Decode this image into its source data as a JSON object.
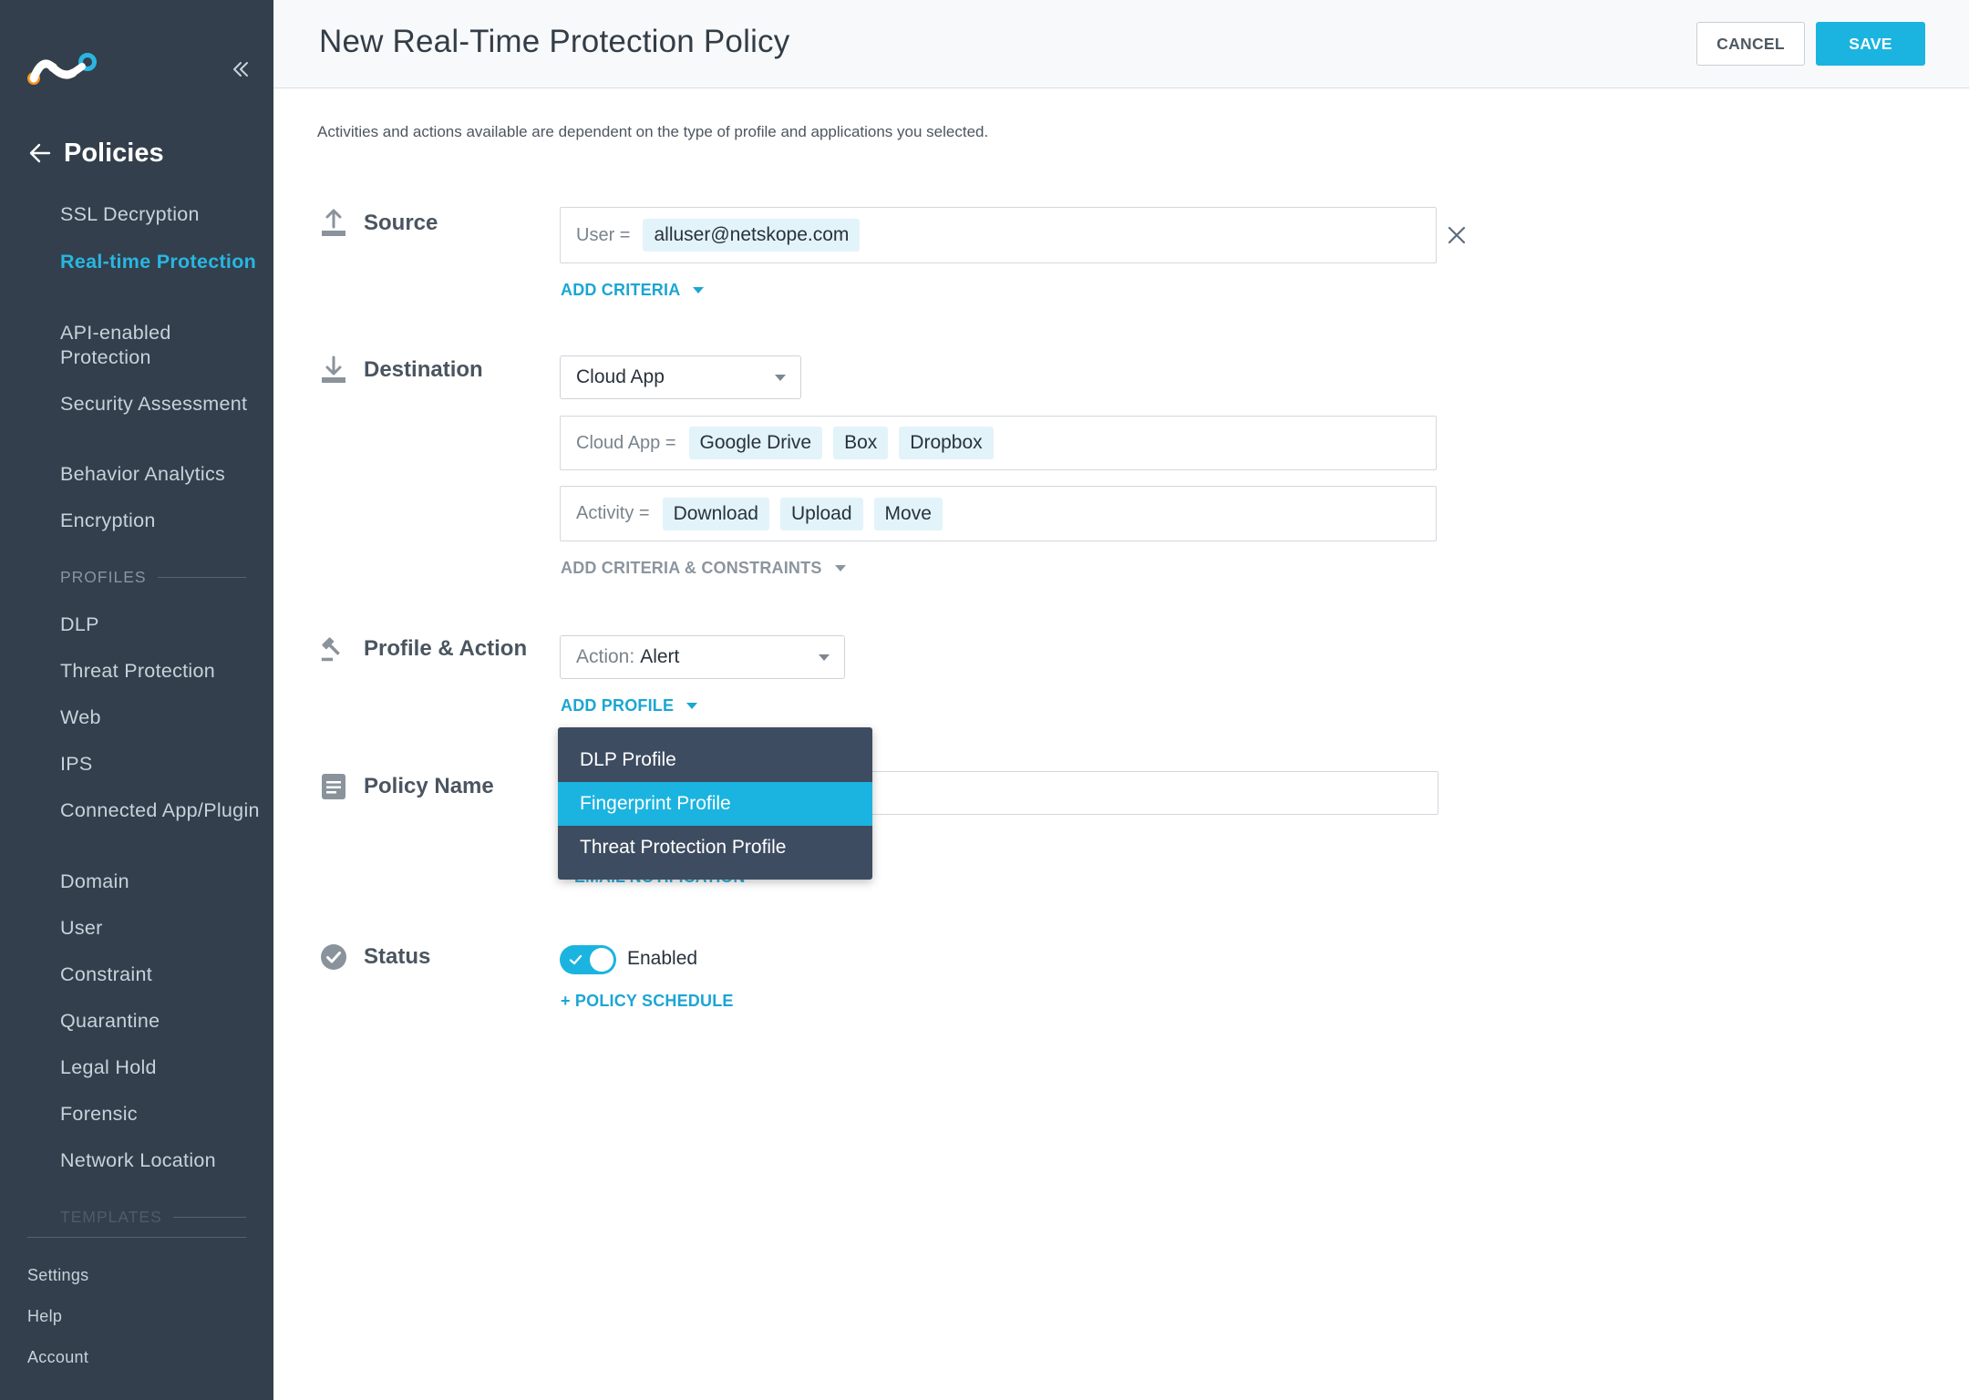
{
  "sidebar": {
    "back_label": "Policies",
    "nav": [
      {
        "label": "SSL Decryption",
        "active": false
      },
      {
        "label": "Real-time Protection",
        "active": true
      },
      {
        "label": "API-enabled Protection",
        "active": false
      },
      {
        "label": "Security Assessment",
        "active": false
      },
      {
        "label": "Behavior Analytics",
        "active": false
      },
      {
        "label": "Encryption",
        "active": false
      }
    ],
    "profiles_label": "PROFILES",
    "profiles": [
      {
        "label": "DLP"
      },
      {
        "label": "Threat Protection"
      },
      {
        "label": "Web"
      },
      {
        "label": "IPS"
      },
      {
        "label": "Connected App/Plugin"
      },
      {
        "label": "Domain"
      },
      {
        "label": "User"
      },
      {
        "label": "Constraint"
      },
      {
        "label": "Quarantine"
      },
      {
        "label": "Legal Hold"
      },
      {
        "label": "Forensic"
      },
      {
        "label": "Network Location"
      }
    ],
    "templates_label": "TEMPLATES",
    "footer": [
      {
        "label": "Settings"
      },
      {
        "label": "Help"
      },
      {
        "label": "Account"
      }
    ]
  },
  "header": {
    "title": "New Real-Time Protection Policy",
    "cancel_label": "CANCEL",
    "save_label": "SAVE"
  },
  "intro_text": "Activities and actions available are dependent on the type of profile and applications you selected.",
  "source": {
    "label": "Source",
    "key": "User =",
    "values": [
      "alluser@netskope.com"
    ],
    "add_criteria_label": "ADD CRITERIA"
  },
  "destination": {
    "label": "Destination",
    "select_value": "Cloud App",
    "cloud_app_key": "Cloud App =",
    "cloud_apps": [
      "Google Drive",
      "Box",
      "Dropbox"
    ],
    "activity_key": "Activity =",
    "activities": [
      "Download",
      "Upload",
      "Move"
    ],
    "add_criteria_label": "ADD CRITERIA & CONSTRAINTS"
  },
  "profile_action": {
    "label": "Profile & Action",
    "action_prefix": "Action:",
    "action_value": "Alert",
    "add_profile_label": "ADD PROFILE",
    "dropdown_options": [
      "DLP Profile",
      "Fingerprint Profile",
      "Threat Protection Profile"
    ],
    "highlighted_option": "Fingerprint Profile"
  },
  "policy_name": {
    "label": "Policy Name",
    "value": "",
    "obscured_link": "EMAIL NOTIFICATION"
  },
  "status": {
    "label": "Status",
    "toggle_label": "Enabled",
    "enabled": true,
    "schedule_link": "+ POLICY SCHEDULE"
  },
  "colors": {
    "sidebar_bg": "#333f4c",
    "accent": "#1bb4e0",
    "dropdown_bg": "#3d4c60",
    "chip_bg": "#e3f3fa"
  }
}
